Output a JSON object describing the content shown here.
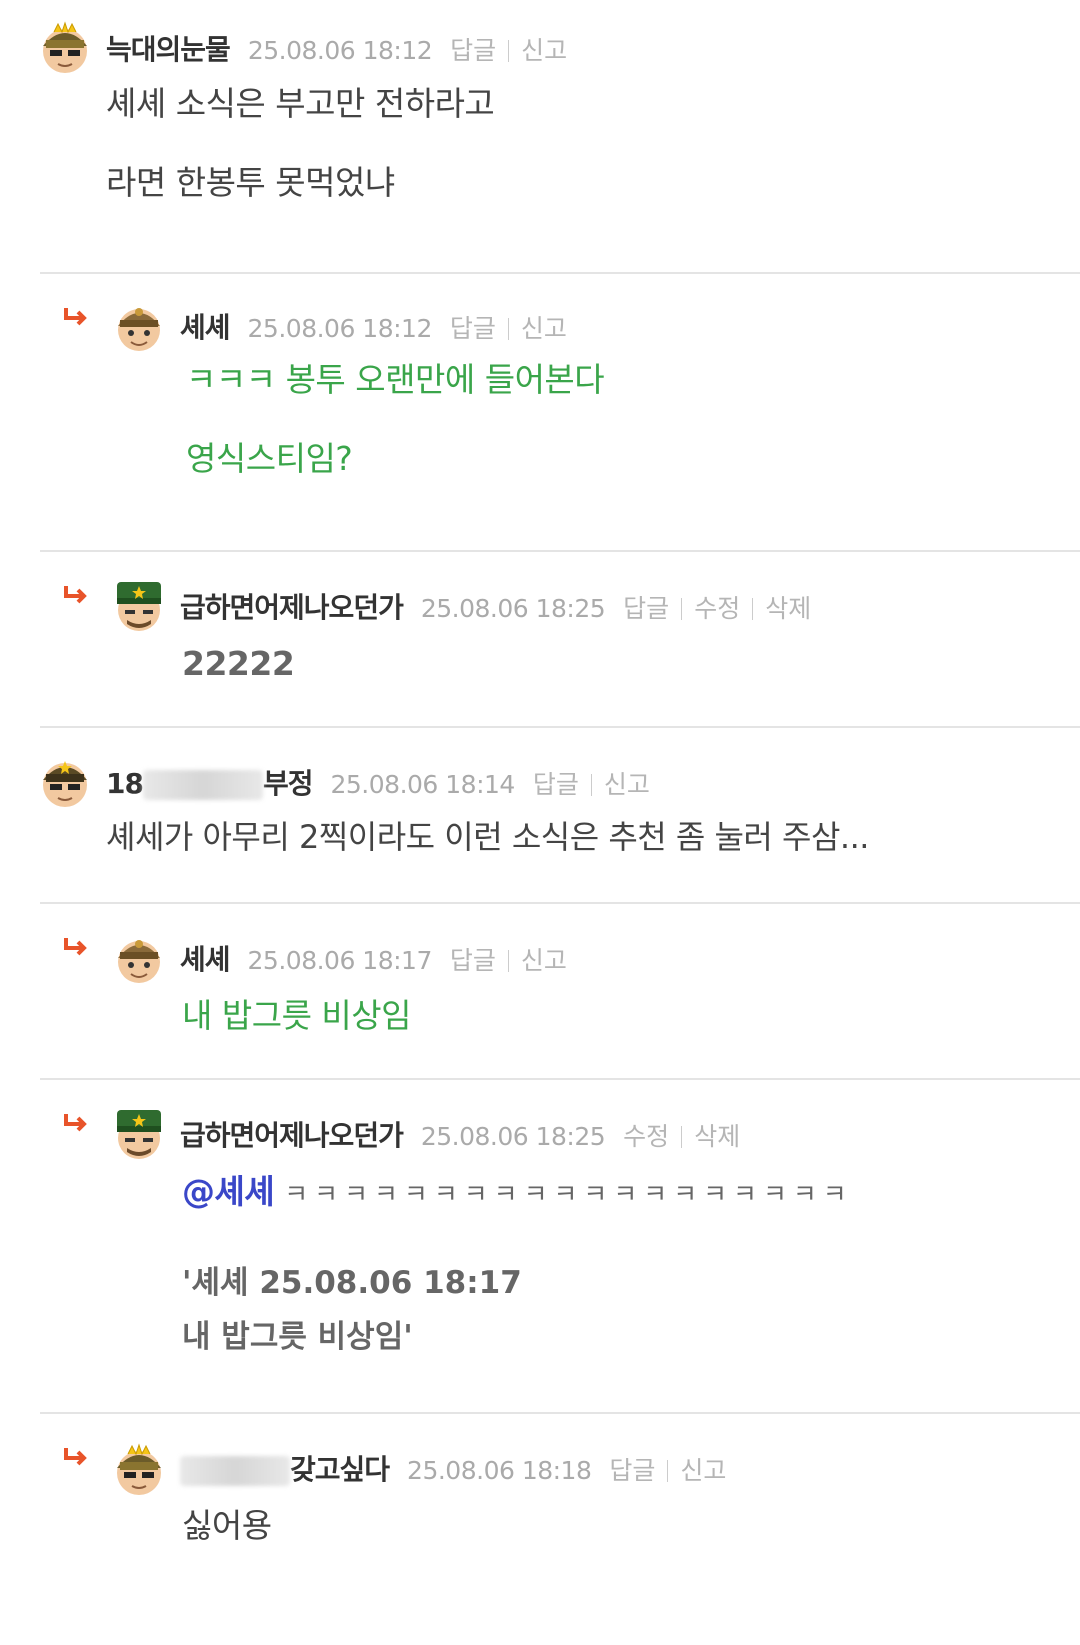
{
  "comments": [
    {
      "nick": "늑대의눈물",
      "date": "25.08.06 18:12",
      "actions": [
        "답글",
        "신고"
      ],
      "body": "셰셰 소식은 부고만 전하라고\n\n라면 한봉투 못먹었냐"
    },
    {
      "nick": "셰셰",
      "date": "25.08.06 18:12",
      "actions": [
        "답글",
        "신고"
      ],
      "body": "ㅋㅋㅋ 봉투 오랜만에 들어본다\n\n영식스티임?"
    },
    {
      "nick": "급하면어제나오던가",
      "date": "25.08.06 18:25",
      "actions": [
        "답글",
        "수정",
        "삭제"
      ],
      "body": "22222"
    },
    {
      "nick_left": "18",
      "nick_right": "부정",
      "date": "25.08.06 18:14",
      "actions": [
        "답글",
        "신고"
      ],
      "body": "셰세가 아무리 2찍이라도 이런 소식은 추천 좀 눌러 주삼..."
    },
    {
      "nick": "셰셰",
      "date": "25.08.06 18:17",
      "actions": [
        "답글",
        "신고"
      ],
      "body": "내 밥그릇 비상임"
    },
    {
      "nick": "급하면어제나오던가",
      "date": "25.08.06 18:25",
      "actions": [
        "수정",
        "삭제"
      ],
      "mention": "@셰셰",
      "laugh": "ㅋㅋㅋㅋㅋㅋㅋㅋㅋㅋㅋㅋㅋㅋㅋㅋㅋㅋㅋ",
      "quote": "'셰셰 25.08.06 18:17\n내 밥그릇 비상임'"
    },
    {
      "nick_left": "",
      "nick_right": "갖고싶다",
      "date": "25.08.06 18:18",
      "actions": [
        "답글",
        "신고"
      ],
      "body": "싫어용"
    }
  ],
  "colors": {
    "reply_arrow": "#e8542a",
    "reply_text": "#3aa54a",
    "mention": "#3a47c8"
  }
}
